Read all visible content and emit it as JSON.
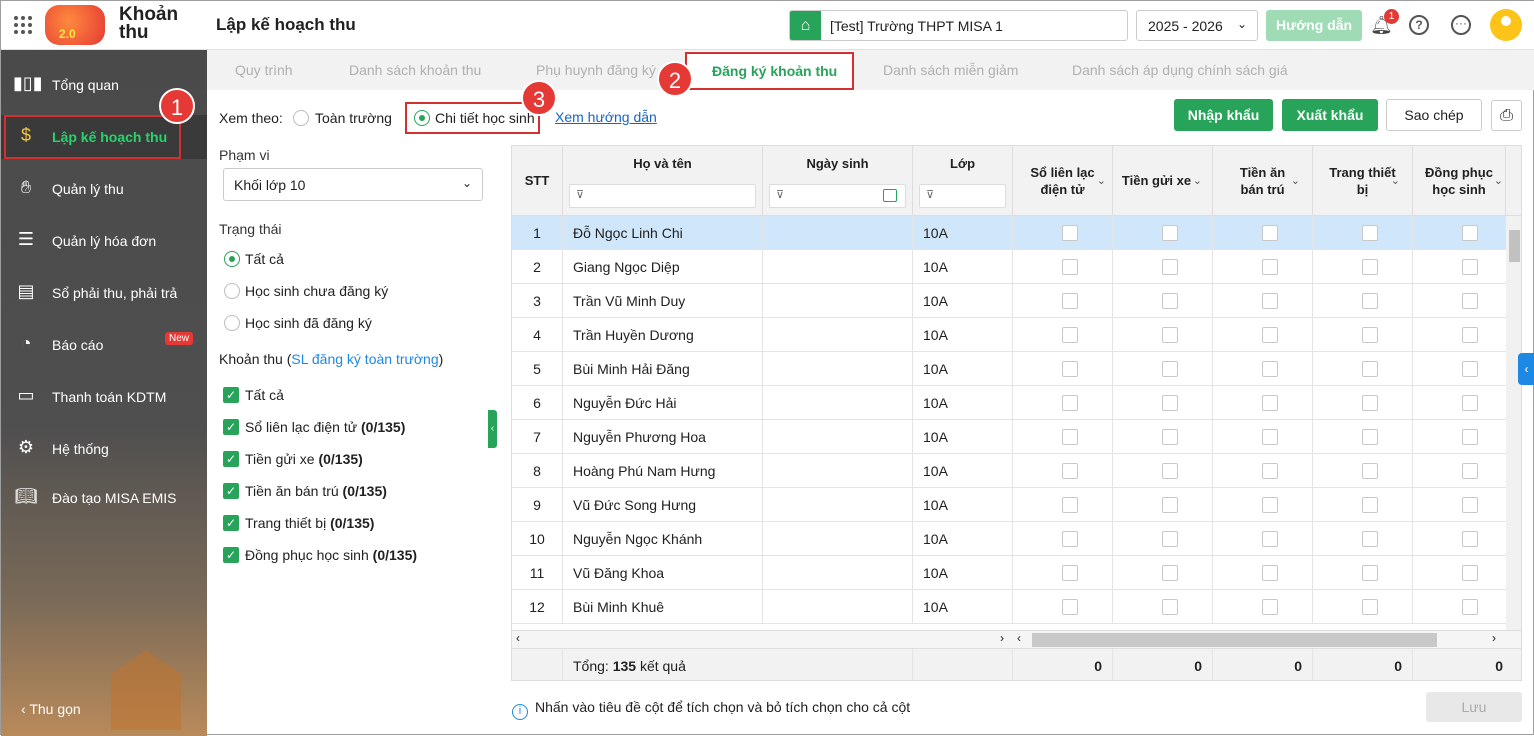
{
  "app": {
    "name": "Khoản thu",
    "logo_badge": "2.0",
    "page_title": "Lập kế hoạch thu"
  },
  "header": {
    "school": "[Test] Trường THPT MISA 1",
    "year": "2025 - 2026",
    "guide_label": "Hướng dẫn",
    "notification_count": "1",
    "help_symbol": "?",
    "more_symbol": "···"
  },
  "sidebar": {
    "items": [
      {
        "label": "Tổng quan",
        "icon": "bar-chart-icon"
      },
      {
        "label": "Lập kế hoạch thu",
        "icon": "calendar-dollar-icon"
      },
      {
        "label": "Quản lý thu",
        "icon": "hand-coin-icon"
      },
      {
        "label": "Quản lý hóa đơn",
        "icon": "document-icon"
      },
      {
        "label": "Sổ phải thu, phải trả",
        "icon": "ledger-icon"
      },
      {
        "label": "Báo cáo",
        "icon": "pie-chart-icon"
      },
      {
        "label": "Thanh toán KDTM",
        "icon": "payment-card-icon"
      },
      {
        "label": "Hệ thống",
        "icon": "gear-icon"
      },
      {
        "label": "Đào tạo MISA EMIS",
        "icon": "book-icon"
      }
    ],
    "new_tag": "New",
    "collapse_label": "Thu gọn"
  },
  "tabs": [
    "Quy trình",
    "Danh sách khoản thu",
    "Phụ huynh đăng ký",
    "Đăng ký khoản thu",
    "Danh sách miễn giảm",
    "Danh sách áp dụng chính sách giá"
  ],
  "annotations": [
    "1",
    "2",
    "3"
  ],
  "view": {
    "label": "Xem theo:",
    "option_school": "Toàn trường",
    "option_detail": "Chi tiết học sinh",
    "guide_link": "Xem hướng dẫn"
  },
  "buttons": {
    "import": "Nhập khẩu",
    "export": "Xuất khẩu",
    "copy": "Sao chép",
    "save": "Lưu"
  },
  "filters": {
    "scope_label": "Phạm vi",
    "scope_value": "Khối lớp 10",
    "status_label": "Trạng thái",
    "status_options": [
      "Tất cả",
      "Học sinh chưa đăng ký",
      "Học sinh đã đăng ký"
    ],
    "fees_label": "Khoản thu (",
    "fees_link": "SL đăng ký toàn trường",
    "fees_label_end": ")",
    "fees": [
      {
        "name": "Tất cả",
        "count": ""
      },
      {
        "name": "Sổ liên lạc điện tử",
        "count": "(0/135)"
      },
      {
        "name": "Tiền gửi xe",
        "count": "(0/135)"
      },
      {
        "name": "Tiền ăn bán trú",
        "count": "(0/135)"
      },
      {
        "name": "Trang thiết bị",
        "count": "(0/135)"
      },
      {
        "name": "Đồng phục học sinh",
        "count": "(0/135)"
      }
    ]
  },
  "table": {
    "headers": {
      "stt": "STT",
      "name": "Họ và tên",
      "dob": "Ngày sinh",
      "class": "Lớp",
      "fee1_a": "Sổ liên lạc",
      "fee1_b": "điện tử",
      "fee2": "Tiền gửi xe",
      "fee3_a": "Tiền ăn",
      "fee3_b": "bán trú",
      "fee4_a": "Trang thiết",
      "fee4_b": "bị",
      "fee5_a": "Đồng phục",
      "fee5_b": "học sinh"
    },
    "rows": [
      {
        "stt": "1",
        "name": "Đỗ Ngọc Linh Chi",
        "class": "10A"
      },
      {
        "stt": "2",
        "name": "Giang Ngọc Diệp",
        "class": "10A"
      },
      {
        "stt": "3",
        "name": "Trần Vũ Minh Duy",
        "class": "10A"
      },
      {
        "stt": "4",
        "name": "Trần Huyền Dương",
        "class": "10A"
      },
      {
        "stt": "5",
        "name": "Bùi Minh Hải Đăng",
        "class": "10A"
      },
      {
        "stt": "6",
        "name": "Nguyễn Đức Hải",
        "class": "10A"
      },
      {
        "stt": "7",
        "name": "Nguyễn Phương Hoa",
        "class": "10A"
      },
      {
        "stt": "8",
        "name": "Hoàng Phú Nam Hưng",
        "class": "10A"
      },
      {
        "stt": "9",
        "name": "Vũ Đức Song Hưng",
        "class": "10A"
      },
      {
        "stt": "10",
        "name": "Nguyễn Ngọc Khánh",
        "class": "10A"
      },
      {
        "stt": "11",
        "name": "Vũ Đăng Khoa",
        "class": "10A"
      },
      {
        "stt": "12",
        "name": "Bùi Minh Khuê",
        "class": "10A"
      }
    ],
    "footer": {
      "total_label": "Tổng:",
      "total_count": "135",
      "total_suffix": "kết quả",
      "sums": [
        "0",
        "0",
        "0",
        "0",
        "0"
      ]
    }
  },
  "info_text": "Nhấn vào tiêu đề cột để tích chọn và bỏ tích chọn cho cả cột"
}
